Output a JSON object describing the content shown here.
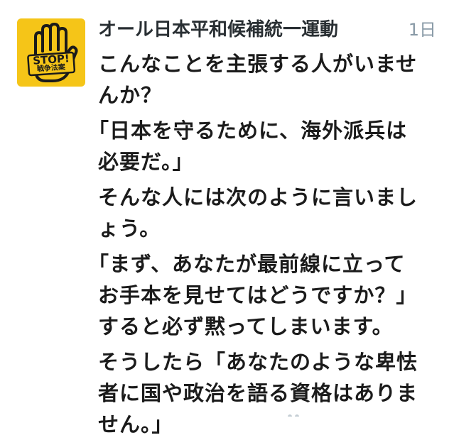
{
  "tweet": {
    "author": {
      "display_name": "オール日本平和候補統一運動",
      "avatar_badge_top": "STOP!",
      "avatar_badge_bottom": "戦争法案",
      "avatar_color": "#f5c518"
    },
    "timestamp": "1日",
    "body_lines": [
      "こんなことを主張する人がいませ",
      "んか？",
      "「日本を守るために、海外派兵は",
      "必要だ。」",
      "そんな人には次のように言いまし",
      "ょう。",
      "「まず、あなたが最前線に立って",
      "お手本を見せてはどうですか？」",
      "すると必ず黙ってしまいます。",
      "そうしたら「あなたのような卑怯",
      "者に国や政治を語る資格はありま",
      "せん。」"
    ]
  },
  "colors": {
    "name": "#292f33",
    "timestamp": "#8899a6",
    "text": "#1b1b1b"
  }
}
